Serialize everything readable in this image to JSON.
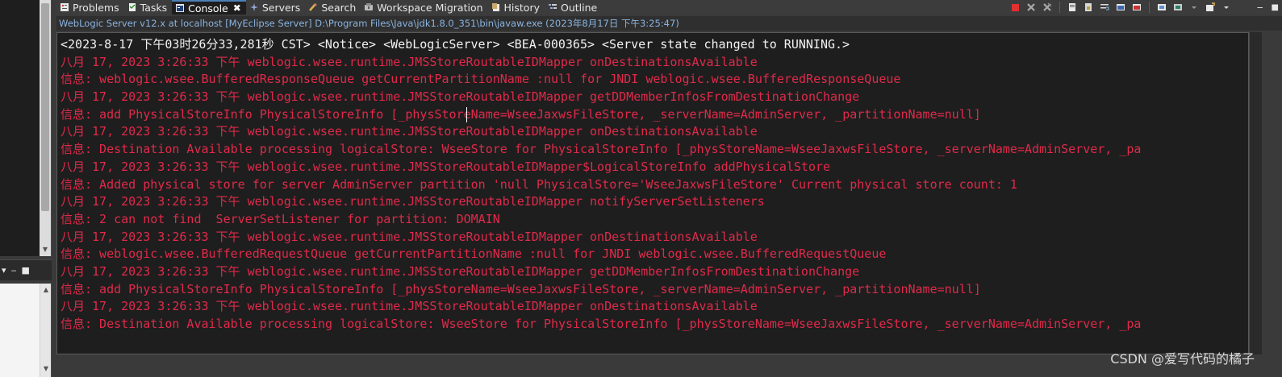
{
  "tabs": [
    {
      "label": "Problems",
      "icon": "problems-icon",
      "active": false
    },
    {
      "label": "Tasks",
      "icon": "tasks-icon",
      "active": false
    },
    {
      "label": "Console",
      "icon": "console-icon",
      "active": true
    },
    {
      "label": "Servers",
      "icon": "servers-icon",
      "active": false
    },
    {
      "label": "Search",
      "icon": "search-icon",
      "active": false
    },
    {
      "label": "Workspace Migration",
      "icon": "workspace-migration-icon",
      "active": false
    },
    {
      "label": "History",
      "icon": "history-icon",
      "active": false
    },
    {
      "label": "Outline",
      "icon": "outline-icon",
      "active": false
    }
  ],
  "console": {
    "close_glyph": "✖",
    "status_line": "WebLogic Server v12.x at localhost [MyEclipse Server] D:\\Program Files\\Java\\jdk1.8.0_351\\bin\\javaw.exe (2023年8月17日 下午3:25:47)",
    "lines": [
      {
        "text": "<2023-8-17 下午03时26分33,281秒 CST> <Notice> <WebLogicServer> <BEA-000365> <Server state changed to RUNNING.>",
        "level": "notice"
      },
      {
        "text": "八月 17, 2023 3:26:33 下午 weblogic.wsee.runtime.JMSStoreRoutableIDMapper onDestinationsAvailable",
        "level": "error"
      },
      {
        "text": "信息: weblogic.wsee.BufferedResponseQueue getCurrentPartitionName :null for JNDI weblogic.wsee.BufferedResponseQueue",
        "level": "error"
      },
      {
        "text": "八月 17, 2023 3:26:33 下午 weblogic.wsee.runtime.JMSStoreRoutableIDMapper getDDMemberInfosFromDestinationChange",
        "level": "error"
      },
      {
        "text": "信息: add PhysicalStoreInfo PhysicalStoreInfo [_physStoreName=WseeJaxwsFileStore, _serverName=AdminServer, _partitionName=null]",
        "level": "error"
      },
      {
        "text": "八月 17, 2023 3:26:33 下午 weblogic.wsee.runtime.JMSStoreRoutableIDMapper onDestinationsAvailable",
        "level": "error"
      },
      {
        "text": "信息: Destination Available processing logicalStore: WseeStore for PhysicalStoreInfo [_physStoreName=WseeJaxwsFileStore, _serverName=AdminServer, _pa",
        "level": "error"
      },
      {
        "text": "八月 17, 2023 3:26:33 下午 weblogic.wsee.runtime.JMSStoreRoutableIDMapper$LogicalStoreInfo addPhysicalStore",
        "level": "error"
      },
      {
        "text": "信息: Added physical store for server AdminServer partition 'null PhysicalStore='WseeJaxwsFileStore' Current physical store count: 1",
        "level": "error"
      },
      {
        "text": "八月 17, 2023 3:26:33 下午 weblogic.wsee.runtime.JMSStoreRoutableIDMapper notifyServerSetListeners",
        "level": "error"
      },
      {
        "text": "信息: 2 can not find  ServerSetListener for partition: DOMAIN",
        "level": "error"
      },
      {
        "text": "八月 17, 2023 3:26:33 下午 weblogic.wsee.runtime.JMSStoreRoutableIDMapper onDestinationsAvailable",
        "level": "error"
      },
      {
        "text": "信息: weblogic.wsee.BufferedRequestQueue getCurrentPartitionName :null for JNDI weblogic.wsee.BufferedRequestQueue",
        "level": "error"
      },
      {
        "text": "八月 17, 2023 3:26:33 下午 weblogic.wsee.runtime.JMSStoreRoutableIDMapper getDDMemberInfosFromDestinationChange",
        "level": "error"
      },
      {
        "text": "信息: add PhysicalStoreInfo PhysicalStoreInfo [_physStoreName=WseeJaxwsFileStore, _serverName=AdminServer, _partitionName=null]",
        "level": "error"
      },
      {
        "text": "八月 17, 2023 3:26:33 下午 weblogic.wsee.runtime.JMSStoreRoutableIDMapper onDestinationsAvailable",
        "level": "error"
      },
      {
        "text": "信息: Destination Available processing logicalStore: WseeStore for PhysicalStoreInfo [_physStoreName=WseeJaxwsFileStore, _serverName=AdminServer, _pa",
        "level": "error"
      }
    ]
  },
  "left_panel": {
    "menu_glyph": "▾",
    "minimize_glyph": "‒",
    "maximize_glyph": "■",
    "scroll_up_glyph": "▲",
    "scroll_down_glyph": "▼"
  },
  "window_controls": {
    "minimize_glyph": "‒",
    "maximize_glyph": "■"
  },
  "watermark": "CSDN @爱写代码的橘子",
  "colors": {
    "console_bg": "#1e1e1e",
    "stderr": "#e02a4a",
    "stdout": "#f2f2f2",
    "status_text": "#8ab4e0",
    "terminate": "#e03030"
  }
}
